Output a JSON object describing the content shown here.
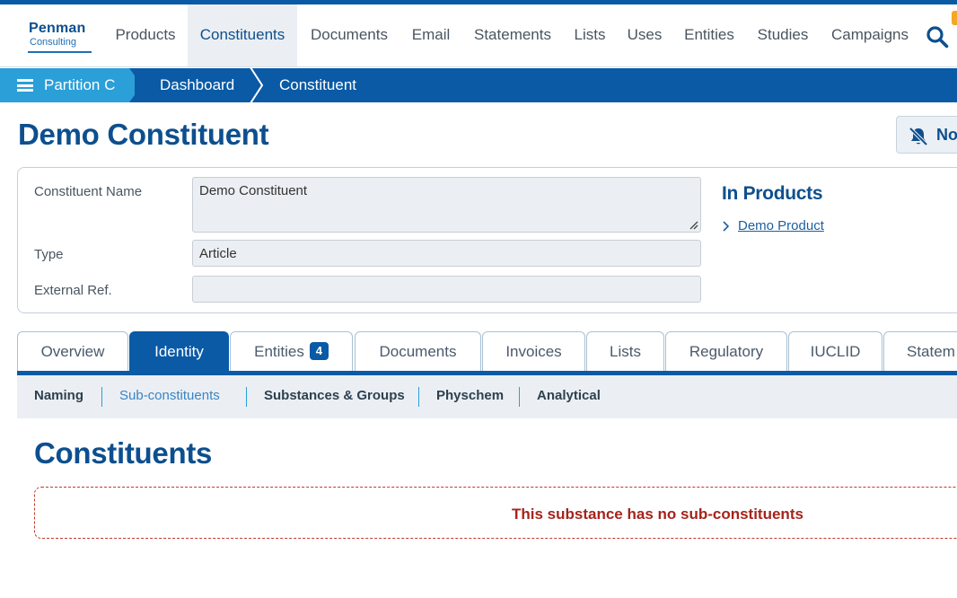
{
  "app": {
    "logo_line1": "Penman",
    "logo_line2": "Consulting"
  },
  "nav": {
    "items": [
      "Products",
      "Constituents",
      "Documents",
      "Email",
      "Statements",
      "Lists",
      "Uses",
      "Entities",
      "Studies",
      "Campaigns"
    ],
    "active": "Constituents"
  },
  "breadcrumb": {
    "partition": "Partition C",
    "items": [
      "Dashboard",
      "Constituent"
    ]
  },
  "page": {
    "title": "Demo Constituent",
    "notification_button": "No"
  },
  "form": {
    "name_label": "Constituent Name",
    "name_value": "Demo Constituent",
    "type_label": "Type",
    "type_value": "Article",
    "extref_label": "External Ref.",
    "extref_value": ""
  },
  "products": {
    "title": "In Products",
    "links": [
      "Demo Product"
    ]
  },
  "tabs": {
    "items": [
      "Overview",
      "Identity",
      "Entities",
      "Documents",
      "Invoices",
      "Lists",
      "Regulatory",
      "IUCLID",
      "Statem"
    ],
    "entities_badge": "4",
    "active": "Identity"
  },
  "subtabs": {
    "items": [
      "Naming",
      "Sub-constituents",
      "Substances & Groups",
      "Physchem",
      "Analytical"
    ],
    "active": "Sub-constituents"
  },
  "section": {
    "title": "Constituents",
    "empty_message": "This substance has no sub-constituents"
  },
  "colors": {
    "primary": "#0a5aa6",
    "partition": "#2a9fd8",
    "title": "#0d4f8e",
    "error": "#a5241c"
  }
}
